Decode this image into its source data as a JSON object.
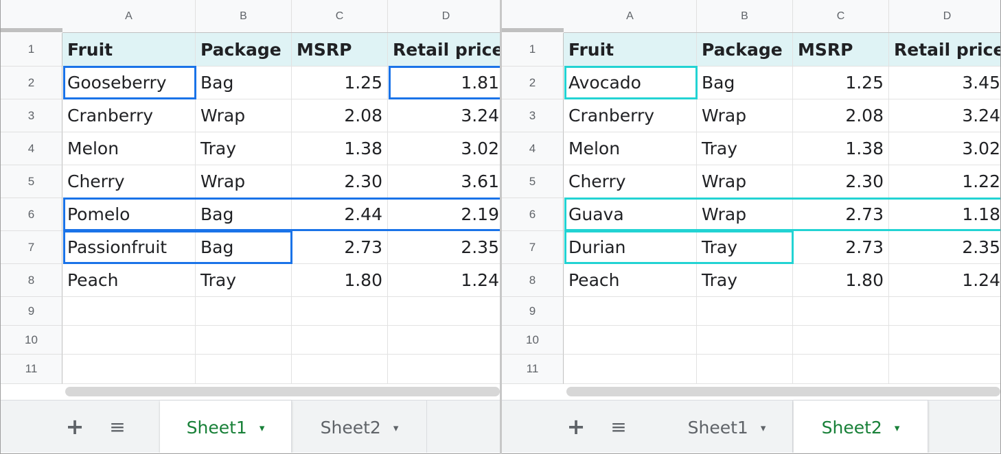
{
  "columns": [
    "A",
    "B",
    "C",
    "D"
  ],
  "row_numbers": [
    "1",
    "2",
    "3",
    "4",
    "5",
    "6",
    "7",
    "8",
    "9",
    "10",
    "11"
  ],
  "header_row": [
    "Fruit",
    "Package",
    "MSRP",
    "Retail price"
  ],
  "sheet1": {
    "rows": [
      [
        "Gooseberry",
        "Bag",
        "1.25",
        "1.81"
      ],
      [
        "Cranberry",
        "Wrap",
        "2.08",
        "3.24"
      ],
      [
        "Melon",
        "Tray",
        "1.38",
        "3.02"
      ],
      [
        "Cherry",
        "Wrap",
        "2.30",
        "3.61"
      ],
      [
        "Pomelo",
        "Bag",
        "2.44",
        "2.19"
      ],
      [
        "Passionfruit",
        "Bag",
        "2.73",
        "2.35"
      ],
      [
        "Peach",
        "Tray",
        "1.80",
        "1.24"
      ]
    ]
  },
  "sheet2": {
    "rows": [
      [
        "Avocado",
        "Bag",
        "1.25",
        "3.45"
      ],
      [
        "Cranberry",
        "Wrap",
        "2.08",
        "3.24"
      ],
      [
        "Melon",
        "Tray",
        "1.38",
        "3.02"
      ],
      [
        "Cherry",
        "Wrap",
        "2.30",
        "1.22"
      ],
      [
        "Guava",
        "Wrap",
        "2.73",
        "1.18"
      ],
      [
        "Durian",
        "Tray",
        "2.73",
        "2.35"
      ],
      [
        "Peach",
        "Tray",
        "1.80",
        "1.24"
      ]
    ]
  },
  "tabs": {
    "add_icon": "plus-icon",
    "list_icon": "sheet-list-icon",
    "add_glyph": "+",
    "list_glyph": "≡",
    "caret_glyph": "▾",
    "sheet1_label": "Sheet1",
    "sheet2_label": "Sheet2"
  },
  "left_pane": {
    "active_tab": "Sheet1"
  },
  "right_pane": {
    "active_tab": "Sheet2"
  },
  "colors": {
    "header_fill": "#dff3f5",
    "highlight_sheet1": "#1a73e8",
    "highlight_sheet2": "#22d3d3",
    "active_tab_text": "#188038"
  }
}
